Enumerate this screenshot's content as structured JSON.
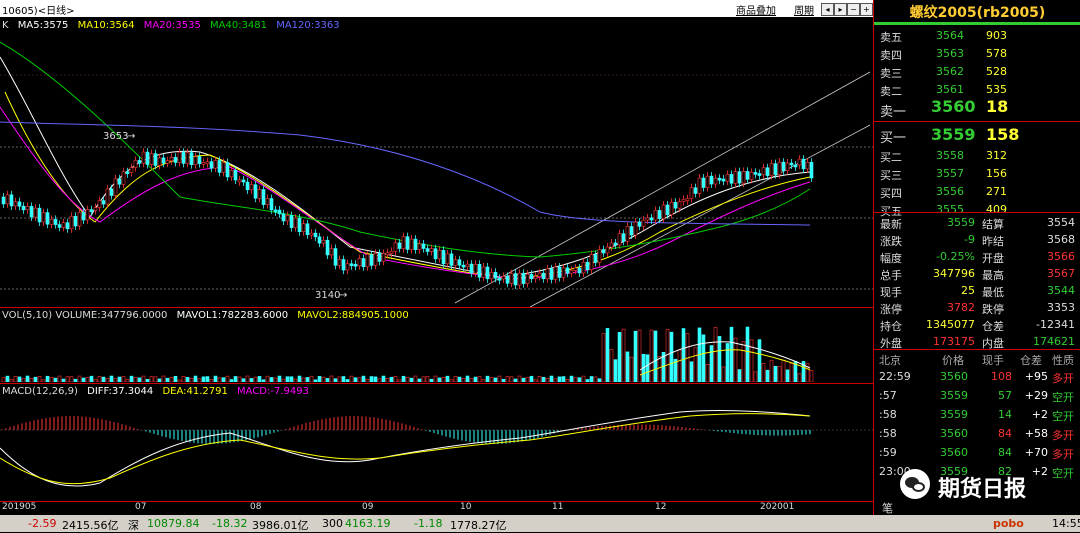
{
  "titlebar": {
    "code": "10605)<日线>",
    "link1": "商品叠加",
    "link2": "周期"
  },
  "ma_legend": {
    "k": "K",
    "ma5": "MA5:3575",
    "ma10": "MA10:3564",
    "ma20": "MA20:3535",
    "ma40": "MA40:3481",
    "ma120": "MA120:3363"
  },
  "price_labels": {
    "high": "3653",
    "low": "3140"
  },
  "volume_legend": {
    "main": "VOL(5,10) VOLUME:347796.0000",
    "mavol1": "MAVOL1:782283.6000",
    "mavol2": "MAVOL2:884905.1000"
  },
  "macd_legend": {
    "main": "MACD(12,26,9)",
    "diff": "DIFF:37.3044",
    "dea": "DEA:41.2791",
    "macd": "MACD:-7.9493"
  },
  "date_axis": [
    "201905",
    "07",
    "08",
    "09",
    "10",
    "11",
    "12",
    "202001"
  ],
  "colors": {
    "ma5": "#ffffff",
    "ma10": "#ffff00",
    "ma20": "#ff00ff",
    "ma40": "#00cc00",
    "ma120": "#6666ff",
    "up": "#ff3333",
    "down": "#33ffff"
  },
  "panel": {
    "title": "螺纹2005(rb2005)",
    "asks": [
      {
        "label": "卖五",
        "price": "3564",
        "vol": "903"
      },
      {
        "label": "卖四",
        "price": "3563",
        "vol": "578"
      },
      {
        "label": "卖三",
        "price": "3562",
        "vol": "528"
      },
      {
        "label": "卖二",
        "price": "3561",
        "vol": "535"
      },
      {
        "label": "卖一",
        "price": "3560",
        "vol": "18"
      }
    ],
    "bids": [
      {
        "label": "买一",
        "price": "3559",
        "vol": "158"
      },
      {
        "label": "买二",
        "price": "3558",
        "vol": "312"
      },
      {
        "label": "买三",
        "price": "3557",
        "vol": "156"
      },
      {
        "label": "买四",
        "price": "3556",
        "vol": "271"
      },
      {
        "label": "买五",
        "price": "3555",
        "vol": "409"
      }
    ],
    "quotes": [
      {
        "l1": "最新",
        "v1": "3559",
        "l2": "结算",
        "v2": "3554"
      },
      {
        "l1": "涨跌",
        "v1": "-9",
        "l2": "昨结",
        "v2": "3568"
      },
      {
        "l1": "幅度",
        "v1": "-0.25%",
        "l2": "开盘",
        "v2": "3566"
      },
      {
        "l1": "总手",
        "v1": "347796",
        "l2": "最高",
        "v2": "3567"
      },
      {
        "l1": "现手",
        "v1": "25",
        "l2": "最低",
        "v2": "3544"
      },
      {
        "l1": "涨停",
        "v1": "3782",
        "l2": "跌停",
        "v2": "3353"
      },
      {
        "l1": "持仓",
        "v1": "1345077",
        "l2": "仓差",
        "v2": "-12341"
      },
      {
        "l1": "外盘",
        "v1": "173175",
        "l2": "内盘",
        "v2": "174621"
      }
    ],
    "tick_header": {
      "c1": "北京",
      "c2": "价格",
      "c3": "现手",
      "c4": "仓差",
      "c5": "性质"
    },
    "ticks": [
      {
        "t": "22:59",
        "p": "3560",
        "v": "108",
        "d": "+95",
        "n": "多开"
      },
      {
        "t": ":57",
        "p": "3559",
        "v": "57",
        "d": "+29",
        "n": "空开"
      },
      {
        "t": ":58",
        "p": "3559",
        "v": "14",
        "d": "+2",
        "n": "空开"
      },
      {
        "t": ":58",
        "p": "3560",
        "v": "84",
        "d": "+58",
        "n": "多开"
      },
      {
        "t": ":59",
        "p": "3560",
        "v": "84",
        "d": "+70",
        "n": "多开"
      },
      {
        "t": "23:00",
        "p": "3559",
        "v": "82",
        "d": "+2",
        "n": "空开"
      }
    ],
    "footer_tab": "笔"
  },
  "watermark": "期货日报",
  "statusbar": {
    "s1a": "-2.59",
    "s1b": "2415.56亿",
    "s2label": "深",
    "s2a": "10879.84",
    "s2b": "-18.32",
    "s2c": "3986.01亿",
    "s3label": "300",
    "s3a": "4163.19",
    "s3b": "-1.18",
    "s3c": "1778.27亿",
    "brand": "pobo",
    "time": "14:55"
  }
}
